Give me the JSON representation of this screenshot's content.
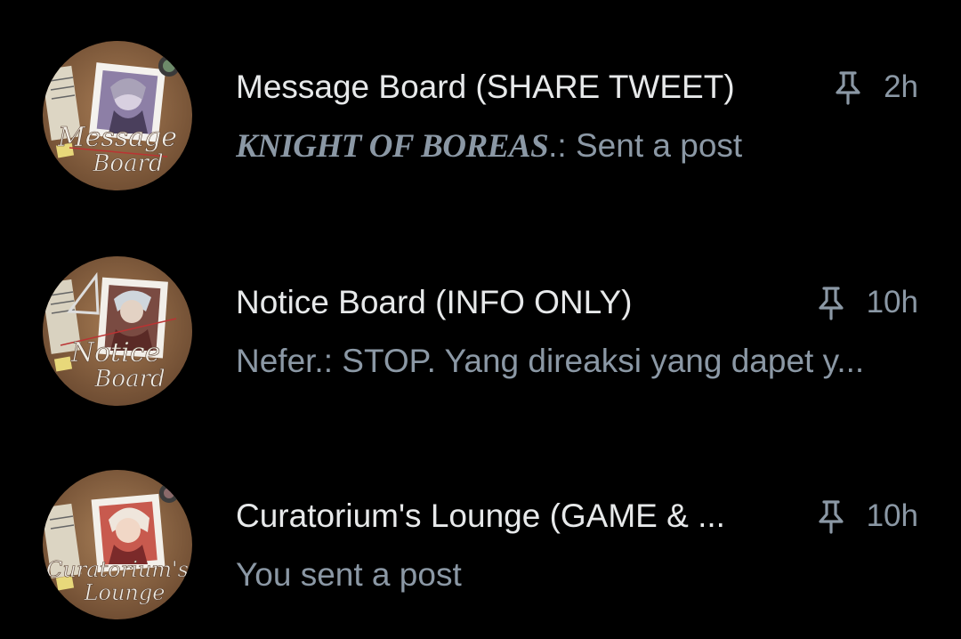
{
  "conversations": [
    {
      "title": "Message Board (SHARE TWEET)",
      "sender": "KNIGHT OF BOREAS",
      "separator": ".: ",
      "message": "Sent a post",
      "time": "2h",
      "pinned_icon": "pin-icon",
      "avatar_icon": "message-board-avatar"
    },
    {
      "title": "Notice Board (INFO ONLY)",
      "sender": "Nefer.",
      "separator": ": ",
      "message": "STOP. Yang direaksi yang dapet y...",
      "time": "10h",
      "pinned_icon": "pin-icon",
      "avatar_icon": "notice-board-avatar"
    },
    {
      "title": "Curatorium's Lounge (GAME & ...",
      "sender": "",
      "separator": "",
      "message": "You sent a post",
      "time": "10h",
      "pinned_icon": "pin-icon",
      "avatar_icon": "lounge-avatar"
    }
  ],
  "colors": {
    "background": "#000000",
    "primary_text": "#e7e9ea",
    "secondary_text": "#8b98a5"
  }
}
